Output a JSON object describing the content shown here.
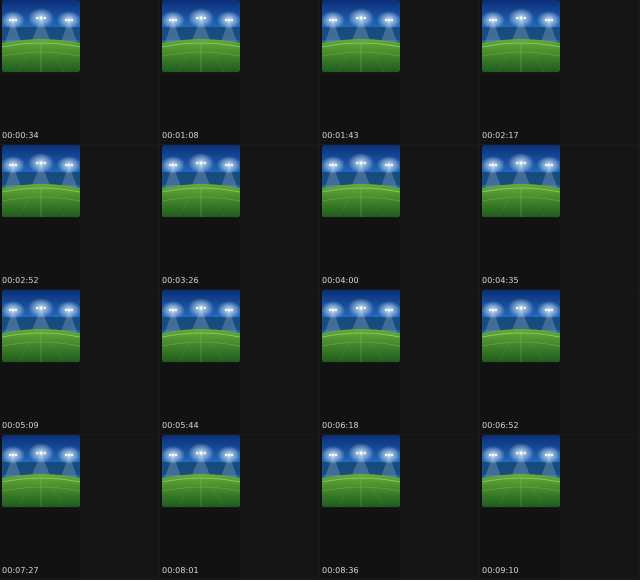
{
  "thumbnail_subject": "stadium-floodlights-grass",
  "colors": {
    "background": "#0e0e0e",
    "sky_top": "#0a2e78",
    "sky_mid": "#2d86dc",
    "grass_dark": "#1e5b1e",
    "grass_light": "#66ad38",
    "timestamp_text": "#d7d7d7"
  },
  "frames": [
    {
      "timestamp": "00:00:34"
    },
    {
      "timestamp": "00:01:08"
    },
    {
      "timestamp": "00:01:43"
    },
    {
      "timestamp": "00:02:17"
    },
    {
      "timestamp": "00:02:52"
    },
    {
      "timestamp": "00:03:26"
    },
    {
      "timestamp": "00:04:00"
    },
    {
      "timestamp": "00:04:35"
    },
    {
      "timestamp": "00:05:09"
    },
    {
      "timestamp": "00:05:44"
    },
    {
      "timestamp": "00:06:18"
    },
    {
      "timestamp": "00:06:52"
    },
    {
      "timestamp": "00:07:27"
    },
    {
      "timestamp": "00:08:01"
    },
    {
      "timestamp": "00:08:36"
    },
    {
      "timestamp": "00:09:10"
    }
  ]
}
